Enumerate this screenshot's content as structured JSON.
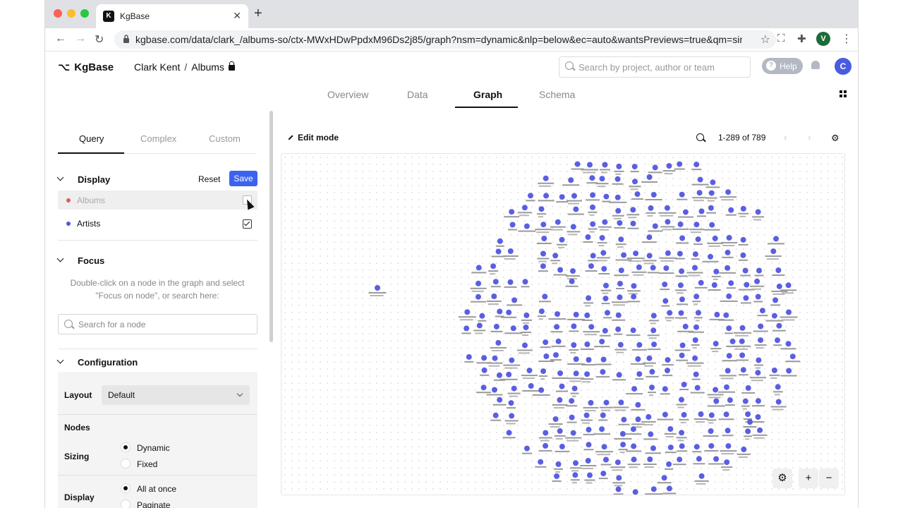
{
  "browser": {
    "tab_title": "KgBase",
    "url": "kgbase.com/data/clark_/albums-so/ctx-MWxHDwPpdxM96Ds2j85/graph?nsm=dynamic&nlp=below&ec=auto&wantsPreviews=true&qm=simpl..."
  },
  "header": {
    "logo": "KgBase",
    "breadcrumb_owner": "Clark Kent",
    "breadcrumb_sep": "/",
    "breadcrumb_project": "Albums",
    "search_placeholder": "Search by project, author or team",
    "help_label": "Help",
    "avatar_letter": "C",
    "profile_letter": "V"
  },
  "main_tabs": [
    {
      "label": "Overview"
    },
    {
      "label": "Data"
    },
    {
      "label": "Graph"
    },
    {
      "label": "Schema"
    }
  ],
  "sidebar": {
    "subtabs": [
      {
        "label": "Query"
      },
      {
        "label": "Complex"
      },
      {
        "label": "Custom"
      }
    ],
    "display": {
      "title": "Display",
      "reset_label": "Reset",
      "save_label": "Save",
      "types": [
        {
          "label": "Albums",
          "checked": false,
          "color": "#e05a5a"
        },
        {
          "label": "Artists",
          "checked": true,
          "color": "#4a5be0"
        }
      ]
    },
    "focus": {
      "title": "Focus",
      "help": "Double-click on a node in the graph and select \"Focus on node\", or search here:",
      "search_placeholder": "Search for a node"
    },
    "configuration": {
      "title": "Configuration",
      "layout_label": "Layout",
      "layout_value": "Default",
      "nodes_label": "Nodes",
      "sizing_label": "Sizing",
      "sizing_options": [
        "Dynamic",
        "Fixed"
      ],
      "sizing_selected": "Dynamic",
      "display_label": "Display",
      "display_options": [
        "All at once",
        "Paginate"
      ],
      "display_selected": "All at once"
    }
  },
  "graph": {
    "edit_mode_label": "Edit mode",
    "range_text": "1-289 of 789",
    "node_color": "#5a5fe0",
    "node_count": 289
  }
}
